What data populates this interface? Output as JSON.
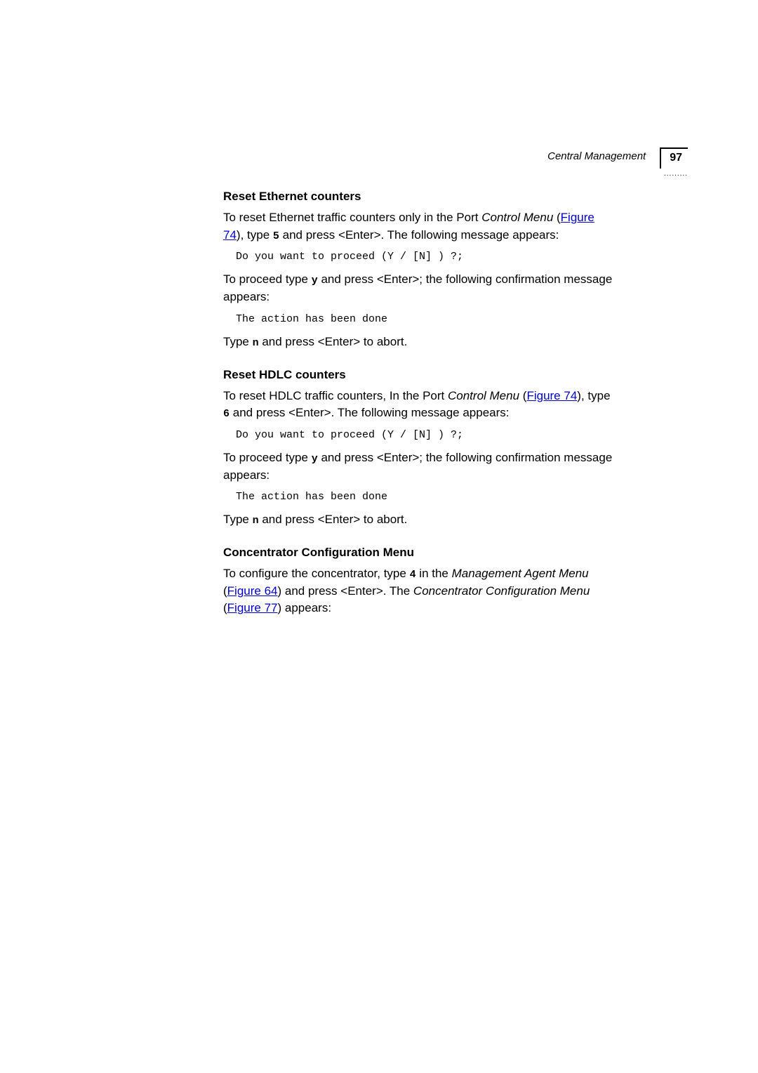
{
  "header": {
    "title": "Central Management",
    "page_number": "97",
    "dots": "........."
  },
  "s1": {
    "heading": "Reset Ethernet counters",
    "p1a": "To reset Ethernet traffic counters only in the Port ",
    "p1b": "Control Menu",
    "p1c": " (",
    "p1link": "Figure 74",
    "p1d": "), type ",
    "p1code": "5",
    "p1e": " and press <Enter>. The following message appears:",
    "code1": "Do you want to proceed (Y / [N] ) ?;",
    "p2a": "To proceed type ",
    "p2code": "y",
    "p2b": " and press <Enter>; the following confirmation message appears:",
    "code2": "The action has been done",
    "p3a": "Type ",
    "p3code": "n",
    "p3b": " and press <Enter> to abort."
  },
  "s2": {
    "heading": "Reset HDLC counters",
    "p1a": "To reset HDLC traffic counters, In the Port ",
    "p1b": "Control Menu",
    "p1c": " (",
    "p1link": "Figure 74",
    "p1d": "), type ",
    "p1code": "6",
    "p1e": " and press <Enter>. The following message appears:",
    "code1": "Do you want to proceed (Y / [N] ) ?;",
    "p2a": "To proceed type ",
    "p2code": "y",
    "p2b": " and press <Enter>; the following confirmation message appears:",
    "code2": "The action has been done",
    "p3a": "Type ",
    "p3code": "n",
    "p3b": " and press <Enter> to abort."
  },
  "s3": {
    "heading": "Concentrator Configuration Menu",
    "p1a": "To configure the concentrator, type ",
    "p1code": "4",
    "p1b": " in the ",
    "p1c": "Management Agent Menu",
    "p1d": " (",
    "p1link1": "Figure 64",
    "p1e": ") and press <Enter>. The ",
    "p1f": "Concentrator Configuration Menu",
    "p1g": " (",
    "p1link2": "Figure 77",
    "p1h": ") appears:"
  }
}
